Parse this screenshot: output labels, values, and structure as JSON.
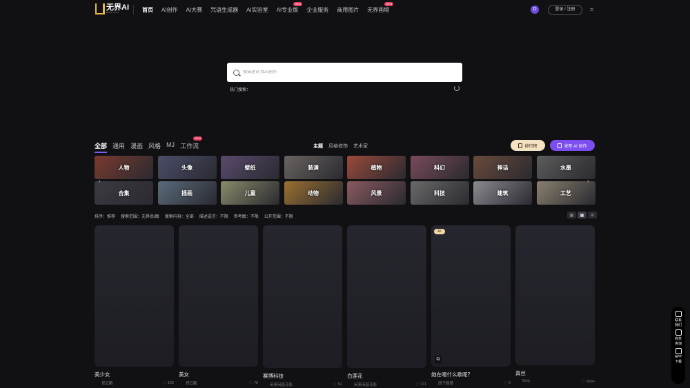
{
  "header": {
    "logo_text": "无界AI",
    "logo_sub": "MOTIFAI",
    "nav": [
      {
        "label": "首页",
        "active": true
      },
      {
        "label": "AI创作"
      },
      {
        "label": "AI大赛"
      },
      {
        "label": "咒语生成器"
      },
      {
        "label": "AI实验室"
      },
      {
        "label": "AI专业版",
        "badge": "NEW"
      },
      {
        "label": "企业服务"
      },
      {
        "label": "商用图片"
      },
      {
        "label": "无界画境",
        "badge": "NEW"
      }
    ],
    "avatar_letter": "D",
    "login_label": "登录 / 注册"
  },
  "search": {
    "placeholder": "搜描述词 找AI创作",
    "hot_label": "热门搜索："
  },
  "category_tabs": [
    {
      "label": "全部",
      "active": true
    },
    {
      "label": "通用"
    },
    {
      "label": "漫画"
    },
    {
      "label": "风格"
    },
    {
      "label": "MJ"
    },
    {
      "label": "工作流",
      "badge": "NEW"
    }
  ],
  "sub_tabs": [
    {
      "label": "主题",
      "active": true
    },
    {
      "label": "风格修饰"
    },
    {
      "label": "艺术家"
    }
  ],
  "rank_button": "排行榜",
  "publish_button": "发布 AI 创作",
  "themes": [
    {
      "label": "人物",
      "color": "#7a3a2e"
    },
    {
      "label": "头像",
      "color": "#4a4e6a"
    },
    {
      "label": "壁纸",
      "color": "#5a4a6e"
    },
    {
      "label": "装潢",
      "color": "#6a6460"
    },
    {
      "label": "植物",
      "color": "#9a4a3a"
    },
    {
      "label": "科幻",
      "color": "#7a4a5a"
    },
    {
      "label": "神话",
      "color": "#6a4a3a"
    },
    {
      "label": "水墨",
      "color": "#5c5c5c"
    },
    {
      "label": "合集",
      "color": "#3a3a40"
    },
    {
      "label": "插画",
      "color": "#5a6a7a"
    },
    {
      "label": "儿童",
      "color": "#8a8a6a"
    },
    {
      "label": "动物",
      "color": "#9a7030"
    },
    {
      "label": "风景",
      "color": "#8a5a60"
    },
    {
      "label": "科技",
      "color": "#6a6a6a"
    },
    {
      "label": "建筑",
      "color": "#8a8a90"
    },
    {
      "label": "工艺",
      "color": "#8a8070"
    }
  ],
  "filters": [
    "排序：推荐",
    "搜索范围：无界尚/图",
    "搜索内容：全部",
    "描述语言：不限",
    "参考图：不限",
    "公开范围：不限"
  ],
  "cards": [
    {
      "title": "美少女",
      "author": "郑云鹏",
      "likes": "150",
      "height": 205
    },
    {
      "title": "美女",
      "author": "郑云鹏",
      "likes": "76",
      "height": 205
    },
    {
      "title": "赛博科技",
      "author": "闲来闲逛花影",
      "likes": "52",
      "height": 207
    },
    {
      "title": "白莲花",
      "author": "闲来闲逛花影",
      "likes": "171",
      "height": 207
    },
    {
      "title": "她在唱什么歌呢？",
      "author": "西子暂晴",
      "likes": "6",
      "height": 205,
      "badge": "4K"
    },
    {
      "title": "真丝",
      "author": "Only",
      "likes": "999+",
      "height": 203
    }
  ],
  "side_float": [
    {
      "label": "联系我们",
      "icon": "headset-icon"
    },
    {
      "label": "商务咨询",
      "icon": "diamond-icon"
    },
    {
      "label": "APP下载",
      "icon": "phone-icon"
    }
  ]
}
